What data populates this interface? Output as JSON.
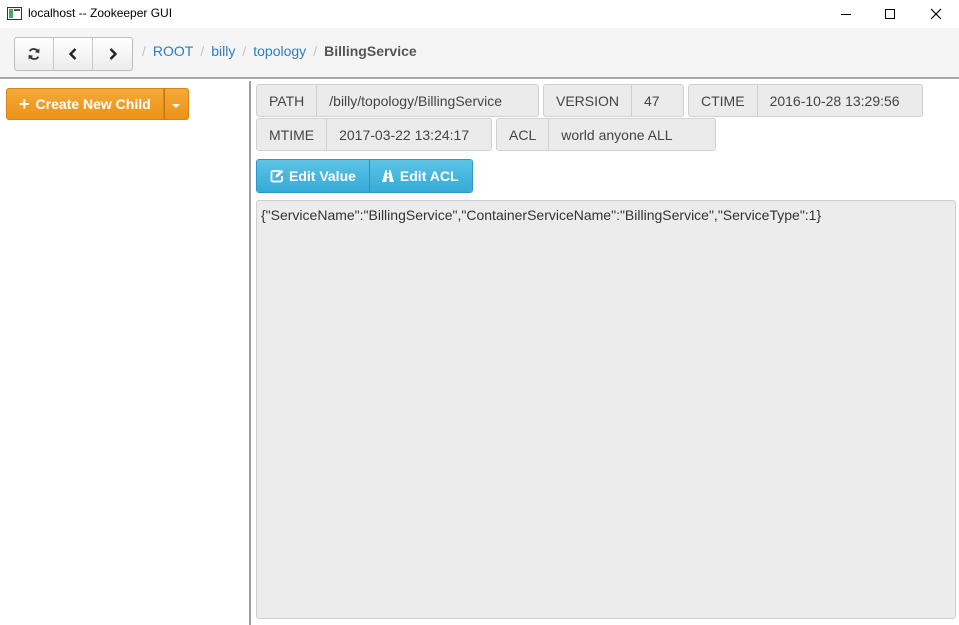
{
  "window": {
    "title": "localhost -- Zookeeper GUI",
    "icon": "app-window-icon",
    "controls": [
      "minimize-icon",
      "maximize-icon",
      "close-icon"
    ]
  },
  "toolbar": {
    "nav_icons": [
      "refresh-icon",
      "back-icon",
      "forward-icon"
    ],
    "breadcrumb": [
      "ROOT",
      "billy",
      "topology",
      "BillingService"
    ],
    "separator": "/"
  },
  "sidebar": {
    "create_label": "Create New Child"
  },
  "node": {
    "path_label": "PATH",
    "path_value": "/billy/topology/BillingService",
    "version_label": "VERSION",
    "version_value": "47",
    "ctime_label": "CTIME",
    "ctime_value": "2016-10-28 13:29:56",
    "mtime_label": "MTIME",
    "mtime_value": "2017-03-22 13:24:17",
    "acl_label": "ACL",
    "acl_value": "world anyone ALL"
  },
  "actions": {
    "edit_value_label": "Edit Value",
    "edit_acl_label": "Edit ACL"
  },
  "content": {
    "value": "{\"ServiceName\":\"BillingService\",\"ContainerServiceName\":\"BillingService\",\"ServiceType\":1}"
  },
  "colors": {
    "create_button": "#ec9215",
    "edit_button": "#36aad6",
    "breadcrumb_link": "#2f7cc0"
  }
}
